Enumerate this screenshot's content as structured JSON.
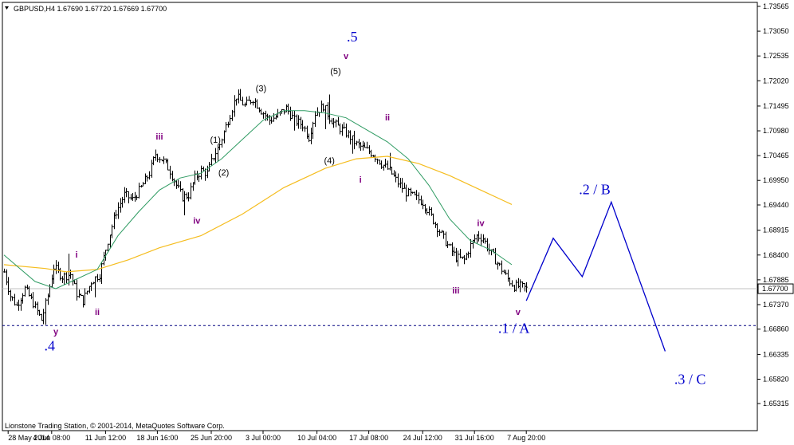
{
  "header": {
    "title": "GBPUSD,H4  1.67690 1.67720 1.67669 1.67700",
    "copyright": "Lionstone Trading Station, © 2001-2014, MetaQuotes Software Corp."
  },
  "chart_data": {
    "type": "candlestick",
    "symbol": "GBPUSD",
    "timeframe": "H4",
    "ohlc_header": {
      "open": 1.6769,
      "high": 1.6772,
      "low": 1.67669,
      "close": 1.677
    },
    "current_price_label": "1.67700",
    "ylim": [
      1.65315,
      1.73565
    ],
    "y_ticks": [
      "1.73565",
      "1.73050",
      "1.72535",
      "1.72020",
      "1.71495",
      "1.70980",
      "1.70465",
      "1.69950",
      "1.69440",
      "1.68915",
      "1.68400",
      "1.67885",
      "1.67370",
      "1.66860",
      "1.66335",
      "1.65820",
      "1.65315"
    ],
    "x_ticks": [
      "28 May 2014",
      "4 Jun 08:00",
      "11 Jun 12:00",
      "18 Jun 16:00",
      "25 Jun 20:00",
      "3 Jul 00:00",
      "10 Jul 04:00",
      "17 Jul 08:00",
      "24 Jul 12:00",
      "31 Jul 16:00",
      "7 Aug 20:00"
    ],
    "price_path": [
      [
        0,
        1.6805
      ],
      [
        3,
        1.6755
      ],
      [
        6,
        1.6735
      ],
      [
        10,
        1.677
      ],
      [
        14,
        1.674
      ],
      [
        18,
        1.6705
      ],
      [
        21,
        1.6755
      ],
      [
        24,
        1.6815
      ],
      [
        28,
        1.6795
      ],
      [
        32,
        1.68
      ],
      [
        35,
        1.676
      ],
      [
        38,
        1.6745
      ],
      [
        42,
        1.6785
      ],
      [
        46,
        1.68
      ],
      [
        50,
        1.687
      ],
      [
        54,
        1.693
      ],
      [
        58,
        1.6965
      ],
      [
        62,
        1.6955
      ],
      [
        66,
        1.698
      ],
      [
        70,
        1.701
      ],
      [
        73,
        1.705
      ],
      [
        77,
        1.7035
      ],
      [
        80,
        1.7015
      ],
      [
        83,
        1.6985
      ],
      [
        86,
        1.696
      ],
      [
        89,
        1.6965
      ],
      [
        92,
        1.7
      ],
      [
        95,
        1.7015
      ],
      [
        98,
        1.701
      ],
      [
        101,
        1.7045
      ],
      [
        104,
        1.707
      ],
      [
        108,
        1.712
      ],
      [
        112,
        1.717
      ],
      [
        116,
        1.715
      ],
      [
        120,
        1.7165
      ],
      [
        124,
        1.714
      ],
      [
        128,
        1.712
      ],
      [
        132,
        1.713
      ],
      [
        136,
        1.7145
      ],
      [
        140,
        1.712
      ],
      [
        144,
        1.711
      ],
      [
        147,
        1.7085
      ],
      [
        150,
        1.7135
      ],
      [
        154,
        1.715
      ],
      [
        157,
        1.7125
      ],
      [
        160,
        1.711
      ],
      [
        163,
        1.71
      ],
      [
        166,
        1.709
      ],
      [
        170,
        1.707
      ],
      [
        174,
        1.706
      ],
      [
        178,
        1.705
      ],
      [
        182,
        1.703
      ],
      [
        186,
        1.7015
      ],
      [
        190,
        1.699
      ],
      [
        194,
        1.697
      ],
      [
        198,
        1.696
      ],
      [
        202,
        1.695
      ],
      [
        206,
        1.692
      ],
      [
        210,
        1.689
      ],
      [
        214,
        1.686
      ],
      [
        218,
        1.6835
      ],
      [
        222,
        1.683
      ],
      [
        225,
        1.686
      ],
      [
        228,
        1.688
      ],
      [
        231,
        1.6875
      ],
      [
        234,
        1.685
      ],
      [
        237,
        1.683
      ],
      [
        240,
        1.681
      ],
      [
        243,
        1.679
      ],
      [
        246,
        1.6775
      ],
      [
        249,
        1.6775
      ],
      [
        252,
        1.677
      ]
    ],
    "spikes": [
      [
        20,
        -0.0025
      ],
      [
        31,
        0.0045
      ],
      [
        44,
        -0.003
      ],
      [
        87,
        -0.003
      ],
      [
        100,
        0.001
      ],
      [
        103,
        -0.0015
      ],
      [
        157,
        0.0045
      ],
      [
        155,
        -0.004
      ],
      [
        140,
        -0.003
      ],
      [
        168,
        -0.003
      ],
      [
        186,
        0.003
      ]
    ],
    "ma_fast": [
      [
        0,
        1.684
      ],
      [
        15,
        1.6785
      ],
      [
        25,
        1.677
      ],
      [
        35,
        1.679
      ],
      [
        45,
        1.681
      ],
      [
        55,
        1.688
      ],
      [
        65,
        1.693
      ],
      [
        75,
        1.6975
      ],
      [
        85,
        1.7
      ],
      [
        95,
        1.701
      ],
      [
        105,
        1.704
      ],
      [
        115,
        1.708
      ],
      [
        125,
        1.712
      ],
      [
        135,
        1.714
      ],
      [
        145,
        1.714
      ],
      [
        155,
        1.7135
      ],
      [
        165,
        1.7125
      ],
      [
        175,
        1.71
      ],
      [
        185,
        1.7075
      ],
      [
        195,
        1.704
      ],
      [
        205,
        1.6985
      ],
      [
        215,
        1.6915
      ],
      [
        225,
        1.687
      ],
      [
        235,
        1.685
      ],
      [
        245,
        1.682
      ]
    ],
    "ma_slow": [
      [
        0,
        1.682
      ],
      [
        20,
        1.6812
      ],
      [
        30,
        1.6805
      ],
      [
        45,
        1.681
      ],
      [
        60,
        1.683
      ],
      [
        75,
        1.6855
      ],
      [
        95,
        1.688
      ],
      [
        115,
        1.6925
      ],
      [
        135,
        1.698
      ],
      [
        155,
        1.702
      ],
      [
        170,
        1.704
      ],
      [
        185,
        1.7045
      ],
      [
        200,
        1.703
      ],
      [
        215,
        1.7005
      ],
      [
        230,
        1.6975
      ],
      [
        245,
        1.6945
      ]
    ],
    "projection_path": [
      [
        252,
        1.6745
      ],
      [
        265,
        1.6875
      ],
      [
        279,
        1.6795
      ],
      [
        293,
        1.695
      ],
      [
        319,
        1.664
      ]
    ],
    "horizontal_lines": {
      "current": 1.677,
      "dashed_support": 1.66935
    },
    "wave_labels": {
      "purple": [
        {
          "text": "i",
          "x": 35,
          "y": 1.6835
        },
        {
          "text": "ii",
          "x": 45,
          "y": 1.6715
        },
        {
          "text": "iii",
          "x": 75,
          "y": 1.708
        },
        {
          "text": "iv",
          "x": 93,
          "y": 1.6905
        },
        {
          "text": "v",
          "x": 165,
          "y": 1.7247
        },
        {
          "text": "ii",
          "x": 185,
          "y": 1.712
        },
        {
          "text": "i",
          "x": 172,
          "y": 1.699
        },
        {
          "text": "iv",
          "x": 230,
          "y": 1.69
        },
        {
          "text": "iii",
          "x": 218,
          "y": 1.676
        },
        {
          "text": "v",
          "x": 248,
          "y": 1.6715
        },
        {
          "text": "y",
          "x": 25,
          "y": 1.6675
        }
      ],
      "black": [
        {
          "text": "(3)",
          "x": 124,
          "y": 1.718
        },
        {
          "text": "(5)",
          "x": 160,
          "y": 1.7216
        },
        {
          "text": "(1)",
          "x": 102,
          "y": 1.7073
        },
        {
          "text": "(2)",
          "x": 106,
          "y": 1.7005
        },
        {
          "text": "(4)",
          "x": 157,
          "y": 1.703
        }
      ],
      "blue": [
        {
          "text": ".5",
          "x": 168,
          "y": 1.7284
        },
        {
          "text": ".4",
          "x": 22,
          "y": 1.6642
        },
        {
          "text": ".1 / A",
          "x": 246,
          "y": 1.6678
        },
        {
          "text": ".2 / B",
          "x": 285,
          "y": 1.6966
        },
        {
          "text": ".3 / C",
          "x": 331,
          "y": 1.6572
        }
      ]
    },
    "colors": {
      "candle": "#000000",
      "ma_fast": "#2e9b62",
      "ma_slow": "#f5bd1f",
      "projection": "#0000cc",
      "current_line": "#c0c0c0",
      "dashed_line": "#000080",
      "wave_purple": "#800080",
      "wave_blue": "#0000cc"
    }
  }
}
